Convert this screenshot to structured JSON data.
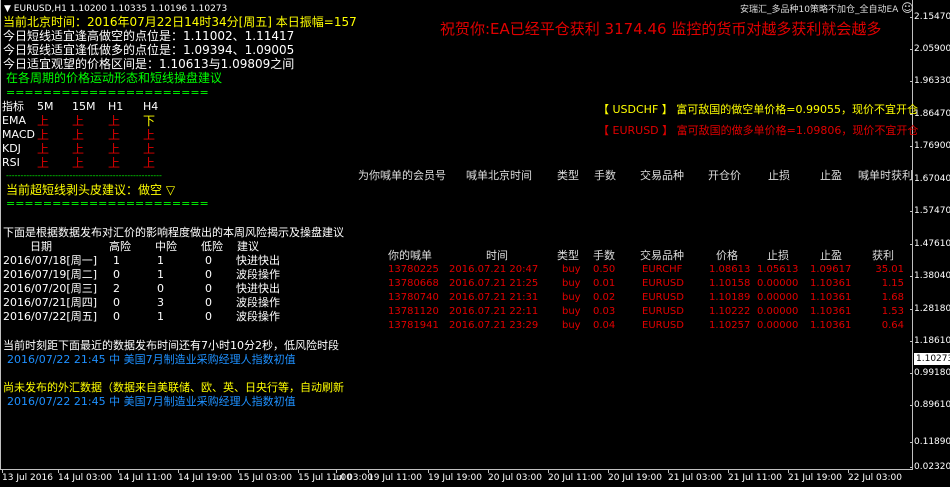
{
  "title_bar": {
    "symbol": "EURUSD,H1",
    "prices": "1.10200 1.10335 1.10196 1.10273"
  },
  "ea_label": "安瑞汇_多品种10策略不加仓_全自动EA",
  "banner": "祝贺你:EA已经平仓获利 3174.46 监控的货币对越多获利就会越多",
  "info": {
    "time": "当前北京时间：2016年07月22日14时34分[周五] 本日振幅=157",
    "high": "今日短线适宜逢高做空的点位是：1.11002、1.11417",
    "low": "今日短线适宜逢低做多的点位是：1.09394、1.09005",
    "watch": "今日适宜观望的价格区间是：1.10613与1.09809之间",
    "period_title": "在各周期的价格运动形态和短线操盘建议",
    "sep1": "======================",
    "sep2": "------------------------------------------------------",
    "suggest": "当前超短线剥头皮建议：做空  ▽",
    "sep3": "======================"
  },
  "indicators": {
    "headers": [
      "指标",
      "5M",
      "15M",
      "H1",
      "H4"
    ],
    "rows": [
      {
        "name": "EMA",
        "v": [
          "上",
          "上",
          "上",
          "下"
        ]
      },
      {
        "name": "MACD",
        "v": [
          "上",
          "上",
          "上",
          "上"
        ]
      },
      {
        "name": "KDJ",
        "v": [
          "上",
          "上",
          "上",
          "上"
        ]
      },
      {
        "name": "RSI",
        "v": [
          "上",
          "上",
          "上",
          "上"
        ]
      }
    ]
  },
  "risk": {
    "title": "下面是根据数据发布对汇价的影响程度做出的本周风险揭示及操盘建议",
    "headers": [
      "日期",
      "高险",
      "中险",
      "低险",
      "建议"
    ],
    "rows": [
      [
        "2016/07/18[周一]",
        "1",
        "1",
        "0",
        "快进快出"
      ],
      [
        "2016/07/19[周二]",
        "0",
        "1",
        "0",
        "波段操作"
      ],
      [
        "2016/07/20[周三]",
        "2",
        "0",
        "0",
        "快进快出"
      ],
      [
        "2016/07/21[周四]",
        "0",
        "3",
        "0",
        "波段操作"
      ],
      [
        "2016/07/22[周五]",
        "0",
        "1",
        "0",
        "波段操作"
      ]
    ]
  },
  "next_release": "当前时刻距下面最近的数据发布时间还有7小时10分2秒，低风险时段",
  "next_event": "2016/07/22 21:45 中 美国7月制造业采购经理人指数初值",
  "pending_title": "尚未发布的外汇数据（数据来自美联储、欧、英、日央行等，自动刷新",
  "pending_event": "2016/07/22 21:45 中 美国7月制造业采购经理人指数初值",
  "alerts": [
    {
      "text1": "【 USDCHF 】",
      "text2": "富可敌国的做空单价格=0.99055，现价不宜开仓",
      "color": "#ffff00"
    },
    {
      "text1": "【 EURUSD 】",
      "text2": "富可敌国的做多单价格=1.09806，现价不宜开仓",
      "color": "#e00000"
    }
  ],
  "call_table": {
    "headers": [
      "为你喊单的会员号",
      "喊单北京时间",
      "类型",
      "手数",
      "交易品种",
      "开仓价",
      "止损",
      "止盈",
      "喊单时获利"
    ]
  },
  "orders": {
    "headers": [
      "你的喊单",
      "时间",
      "类型",
      "手数",
      "交易品种",
      "价格",
      "止损",
      "止盈",
      "获利"
    ],
    "rows": [
      [
        "13780225",
        "2016.07.21 20:47",
        "buy",
        "0.50",
        "EURCHF",
        "1.08613",
        "1.05613",
        "1.09617",
        "35.01"
      ],
      [
        "13780668",
        "2016.07.21 21:25",
        "buy",
        "0.01",
        "EURUSD",
        "1.10158",
        "0.00000",
        "1.10361",
        "1.15"
      ],
      [
        "13780740",
        "2016.07.21 21:31",
        "buy",
        "0.02",
        "EURUSD",
        "1.10189",
        "0.00000",
        "1.10361",
        "1.68"
      ],
      [
        "13781120",
        "2016.07.21 22:11",
        "buy",
        "0.03",
        "EURUSD",
        "1.10222",
        "0.00000",
        "1.10361",
        "1.53"
      ],
      [
        "13781941",
        "2016.07.21 23:29",
        "buy",
        "0.04",
        "EURUSD",
        "1.10257",
        "0.00000",
        "1.10361",
        "0.64"
      ]
    ]
  },
  "y_axis": [
    "2.15470",
    "2.05900",
    "1.96330",
    "1.86470",
    "1.76900",
    "1.67040",
    "1.57470",
    "1.47610",
    "1.38040",
    "1.28180",
    "1.18610",
    "0.99180",
    "0.89610",
    "0.11890",
    "0.02320"
  ],
  "current_price": "1.10273",
  "x_axis": [
    "13 Jul 2016",
    "14 Jul 03:00",
    "14 Jul 11:00",
    "14 Jul 19:00",
    "15 Jul 03:00",
    "15 Jul 11:00",
    "ul 03:00",
    "19 Jul 11:00",
    "19 Jul 19:00",
    "20 Jul 03:00",
    "20 Jul 11:00",
    "20 Jul 19:00",
    "21 Jul 03:00",
    "21 Jul 11:00",
    "21 Jul 19:00",
    "22 Jul 03:00"
  ]
}
